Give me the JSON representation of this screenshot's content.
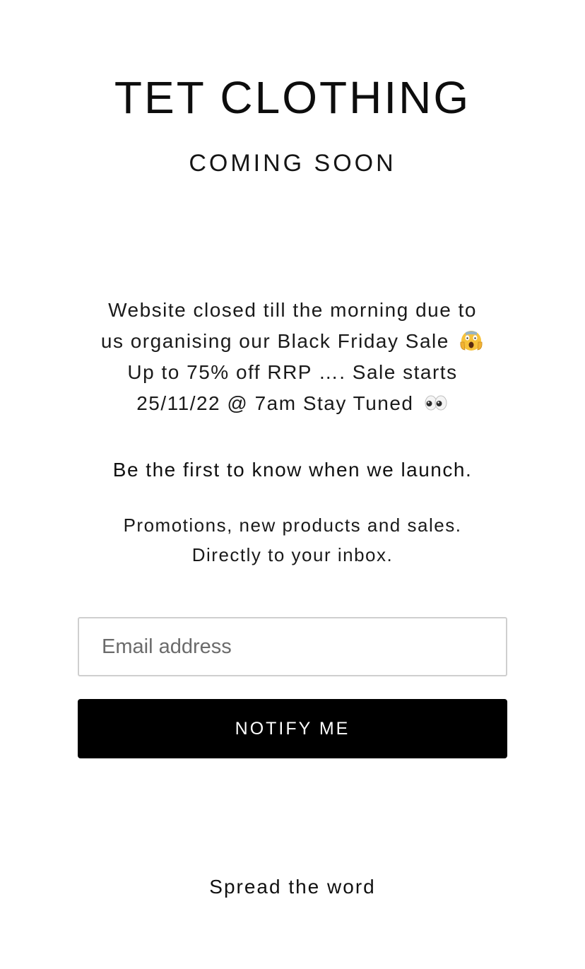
{
  "brand": {
    "title": "TET CLOTHING",
    "subtitle": "COMING SOON"
  },
  "announcement": {
    "line1": "Website closed till the morning due to",
    "line2": "us organising our Black Friday Sale",
    "line2_emoji": "face-screaming-in-fear-icon",
    "line3": "Up to 75% off RRP …. Sale starts",
    "line4": "25/11/22 @ 7am Stay Tuned",
    "line4_emoji": "eyes-icon"
  },
  "launch": {
    "text": "Be the first to know when we launch."
  },
  "promo": {
    "line1": "Promotions, new products and sales.",
    "line2": "Directly to your inbox."
  },
  "signup": {
    "email_placeholder": "Email address",
    "email_value": "",
    "button_label": "NOTIFY ME"
  },
  "footer": {
    "spread_text": "Spread the word"
  },
  "colors": {
    "background": "#ffffff",
    "text": "#111111",
    "button_bg": "#000000",
    "button_text": "#ffffff",
    "input_border": "#cfcfcf"
  }
}
